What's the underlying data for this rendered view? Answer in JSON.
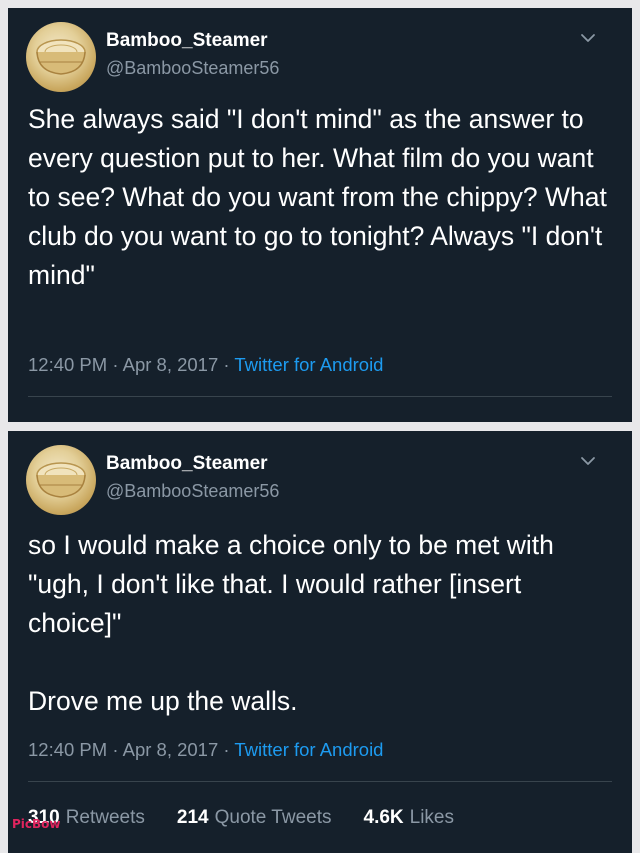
{
  "tweets": [
    {
      "display_name": "Bamboo_Steamer",
      "handle": "@BambooSteamer56",
      "text": "She always said \"I don't mind\" as the answer to every question put to her. What film do you want to see? What do you want from the chippy? What club do you want to go to tonight? Always \"I don't mind\"",
      "time": "12:40 PM",
      "date": "Apr 8, 2017",
      "source": "Twitter for Android",
      "separator": " · "
    },
    {
      "display_name": "Bamboo_Steamer",
      "handle": "@BambooSteamer56",
      "text": "so I would make a choice only to be met with \"ugh, I don't like that. I would rather [insert choice]\"\n\nDrove me up the walls.",
      "time": "12:40 PM",
      "date": "Apr 8, 2017",
      "source": "Twitter for Android",
      "separator": " · ",
      "stats": {
        "retweets_count": "310",
        "retweets_label": "Retweets",
        "quotes_count": "214",
        "quotes_label": "Quote Tweets",
        "likes_count": "4.6K",
        "likes_label": "Likes"
      }
    }
  ],
  "watermark": "PicBow",
  "colors": {
    "background": "#15202b",
    "secondary_text": "#8b98a5",
    "link": "#1d9bf0"
  },
  "icons": {
    "avatar": "bamboo-steamer-avatar",
    "menu": "chevron-down-icon"
  }
}
